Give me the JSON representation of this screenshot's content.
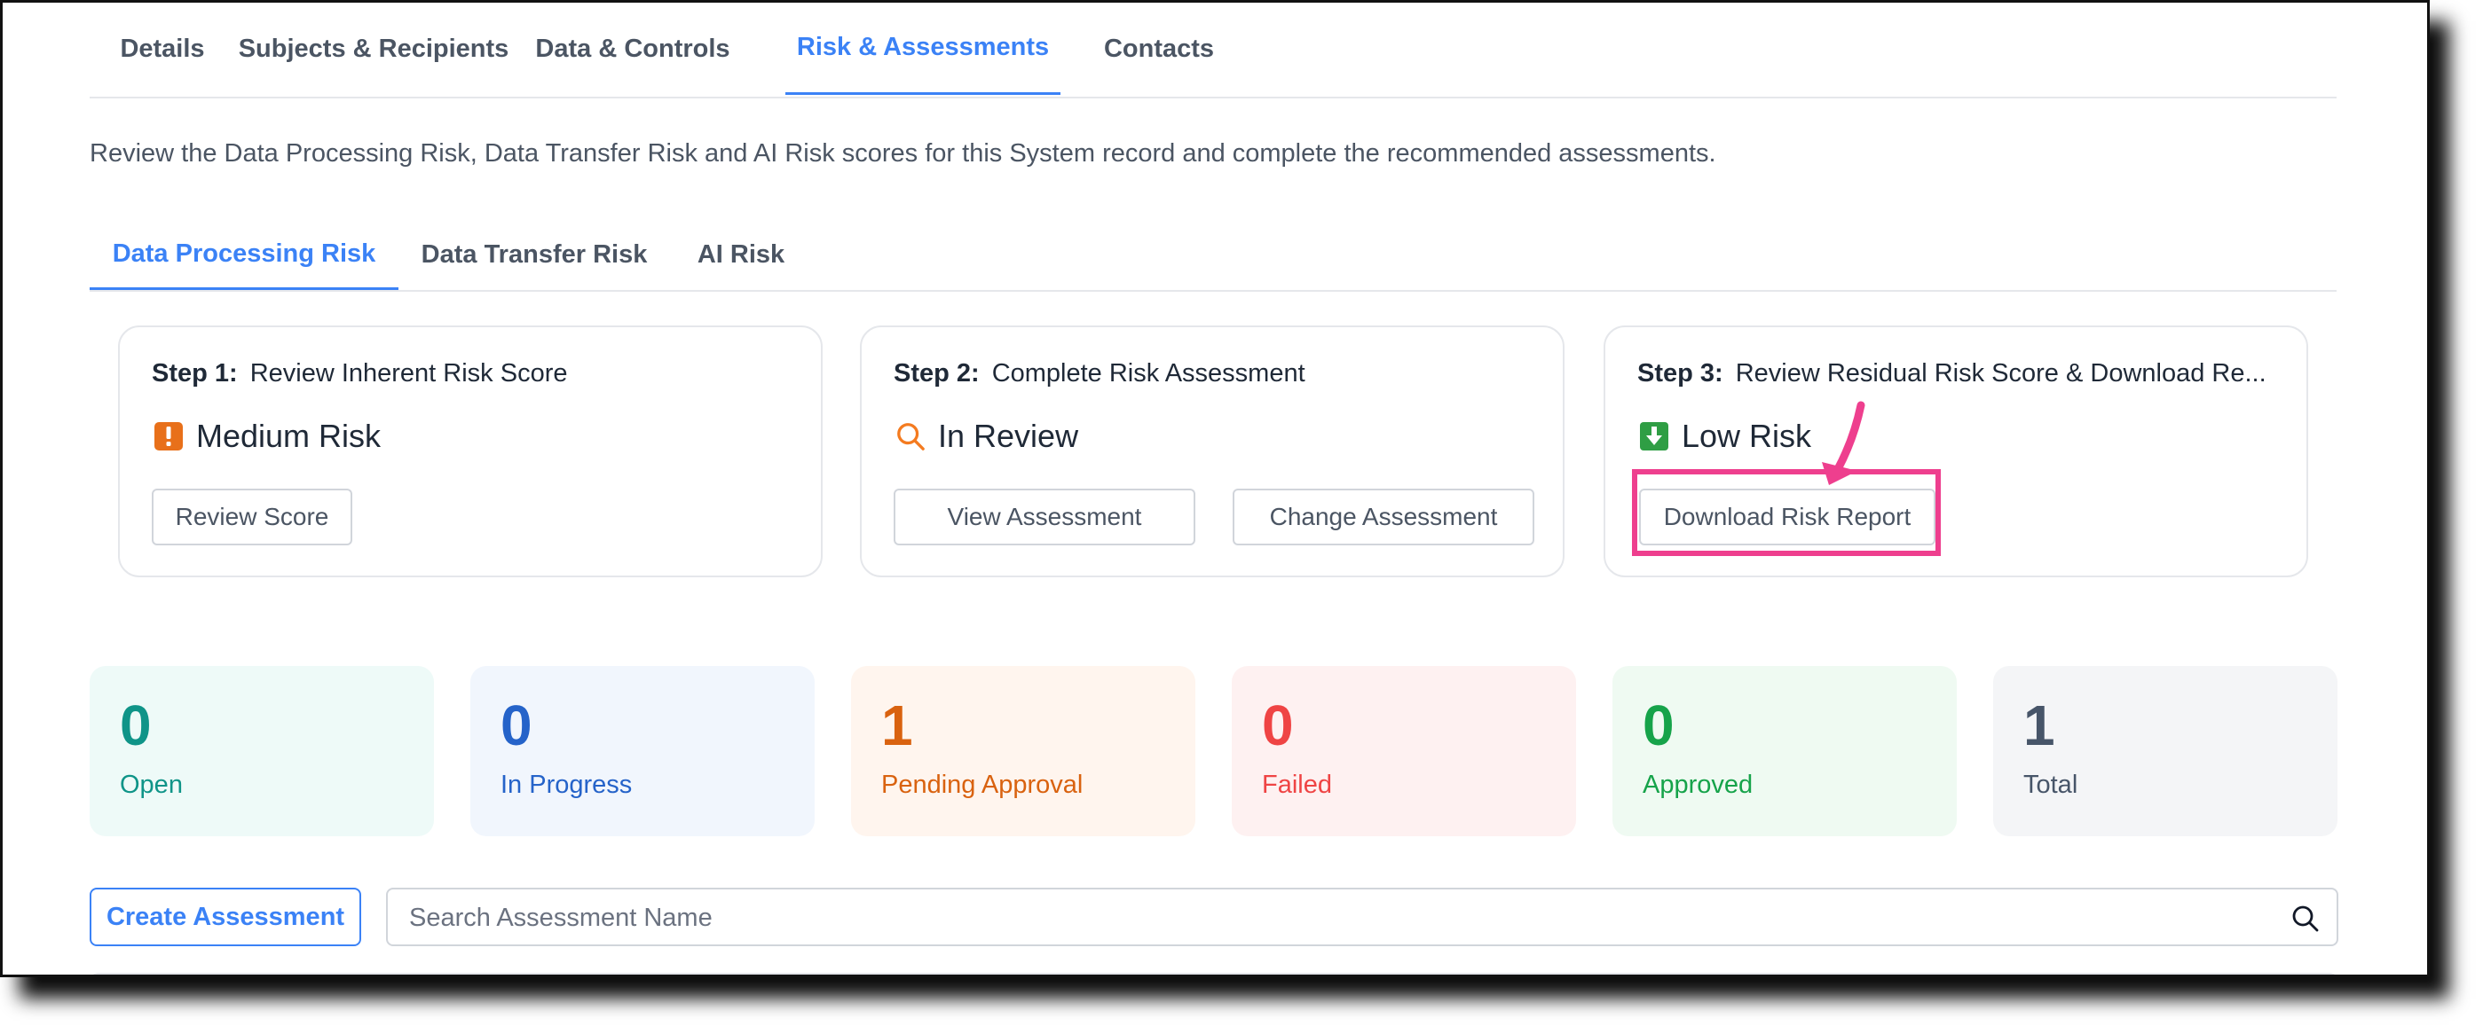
{
  "top_tabs": [
    {
      "label": "Details",
      "active": false
    },
    {
      "label": "Subjects & Recipients",
      "active": false
    },
    {
      "label": "Data & Controls",
      "active": false
    },
    {
      "label": "Risk & Assessments",
      "active": true
    },
    {
      "label": "Contacts",
      "active": false
    }
  ],
  "intro_text": "Review the Data Processing Risk, Data Transfer Risk and AI Risk scores for this System record and complete the recommended assessments.",
  "sub_tabs": [
    {
      "label": "Data Processing Risk",
      "active": true
    },
    {
      "label": "Data Transfer Risk",
      "active": false
    },
    {
      "label": "AI Risk",
      "active": false
    }
  ],
  "steps": [
    {
      "step_label": "Step 1:",
      "title": "Review Inherent Risk Score",
      "status": "Medium Risk",
      "status_icon": "warning-icon",
      "status_color": "#e8701a",
      "buttons": [
        "Review Score"
      ]
    },
    {
      "step_label": "Step 2:",
      "title": "Complete Risk Assessment",
      "status": "In Review",
      "status_icon": "search-icon",
      "status_color": "#f47b20",
      "buttons": [
        "View Assessment",
        "Change Assessment"
      ]
    },
    {
      "step_label": "Step 3:",
      "title": "Review Residual Risk Score & Download Re...",
      "status": "Low Risk",
      "status_icon": "download-icon",
      "status_color": "#2f9e44",
      "buttons": [
        "Download Risk Report"
      ]
    }
  ],
  "stats": [
    {
      "value": "0",
      "label": "Open",
      "color": "#0f9488",
      "bg": "#eefaf8"
    },
    {
      "value": "0",
      "label": "In Progress",
      "color": "#2563c9",
      "bg": "#f1f6fd"
    },
    {
      "value": "1",
      "label": "Pending Approval",
      "color": "#d9620f",
      "bg": "#fff5ee"
    },
    {
      "value": "0",
      "label": "Failed",
      "color": "#ef4444",
      "bg": "#fef1f1"
    },
    {
      "value": "0",
      "label": "Approved",
      "color": "#16a34a",
      "bg": "#effaf2"
    },
    {
      "value": "1",
      "label": "Total",
      "color": "#475569",
      "bg": "#f4f5f7"
    }
  ],
  "create_button_label": "Create Assessment",
  "search": {
    "placeholder": "Search Assessment Name",
    "value": ""
  },
  "annotation_color": "#ee3f8e"
}
